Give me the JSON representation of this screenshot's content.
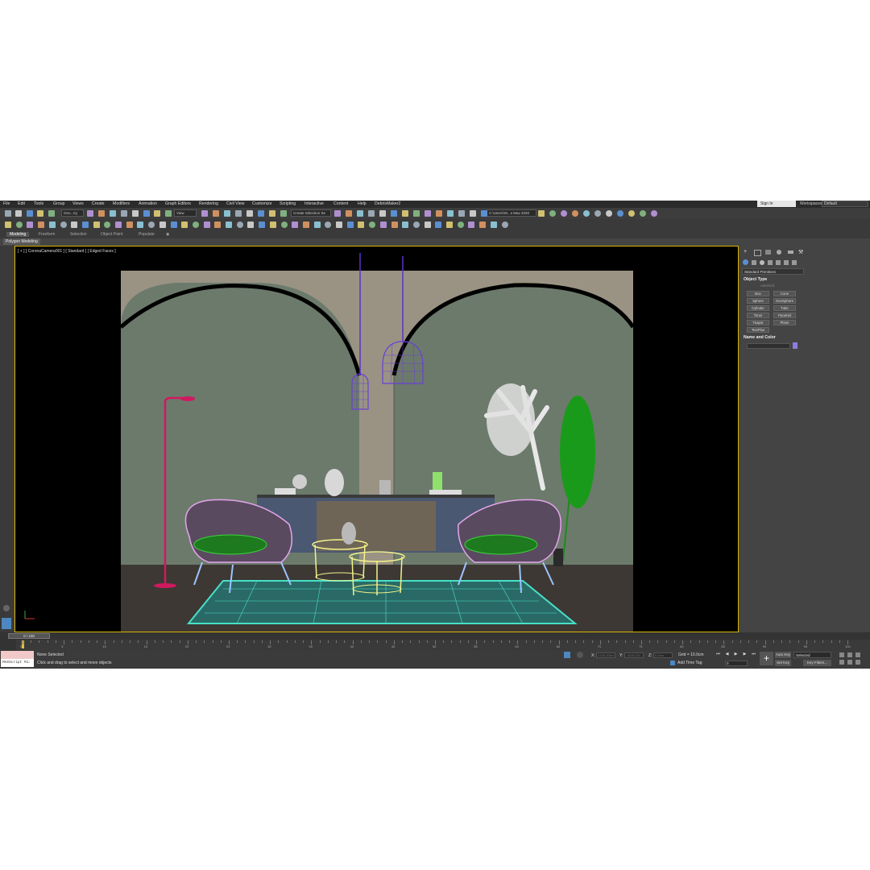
{
  "menu": [
    "File",
    "Edit",
    "Tools",
    "Group",
    "Views",
    "Create",
    "Modifiers",
    "Animation",
    "Graph Editors",
    "Rendering",
    "Civil View",
    "Customize",
    "Scripting",
    "Interactive",
    "Content",
    "Help",
    "DebrisMaker2"
  ],
  "account": {
    "sign_in": "Sign In",
    "workspaces_label": "Workspaces:",
    "workspace_value": "Default"
  },
  "toolbar": {
    "selection_filter": "Geo...try",
    "view_dropdown": "View",
    "selection_set": "Create Selection Se",
    "project_path": "C:\\Users\\St...s Max 2020"
  },
  "ribbon": {
    "tabs": [
      "Modeling",
      "Freeform",
      "Selection",
      "Object Paint",
      "Populate"
    ],
    "active": "Modeling",
    "sub_label": "Polygon Modeling"
  },
  "viewport": {
    "label": "[ + ] [ CoronaCamera001 ] [ Standard ] [ Edged Faces ]"
  },
  "command_panel": {
    "category": "Standard Primitives",
    "object_type_title": "Object Type",
    "autogrid": "AutoGrid",
    "buttons": [
      "Box",
      "Cone",
      "Sphere",
      "GeoSphere",
      "Cylinder",
      "Tube",
      "Torus",
      "Pyramid",
      "Teapot",
      "Plane",
      "TextPlus"
    ],
    "name_color_title": "Name and Color",
    "color_swatch": "#8a7fe0"
  },
  "timeline": {
    "frame_display": "0 / 100",
    "ticks": [
      "0",
      "5",
      "10",
      "15",
      "20",
      "25",
      "30",
      "35",
      "40",
      "45",
      "50",
      "55",
      "60",
      "65",
      "70",
      "75",
      "80",
      "85",
      "90",
      "95",
      "100"
    ]
  },
  "status": {
    "maxscript_label": "MAXScript Mi:",
    "selection_text": "None Selected",
    "prompt_text": "Click and drag to select and move objects",
    "x_label": "X:",
    "y_label": "Y:",
    "z_label": "Z:",
    "x_value": "2139.106m",
    "y_value": "-1616.024",
    "z_value": "0.0cm",
    "grid_text": "Grid = 10.0cm",
    "add_time_tag": "Add Time Tag",
    "auto_key": "Auto Key",
    "set_key": "Set Key",
    "selected_dropdown": "Selected",
    "key_filters": "Key Filters...",
    "frame_value": "0"
  }
}
